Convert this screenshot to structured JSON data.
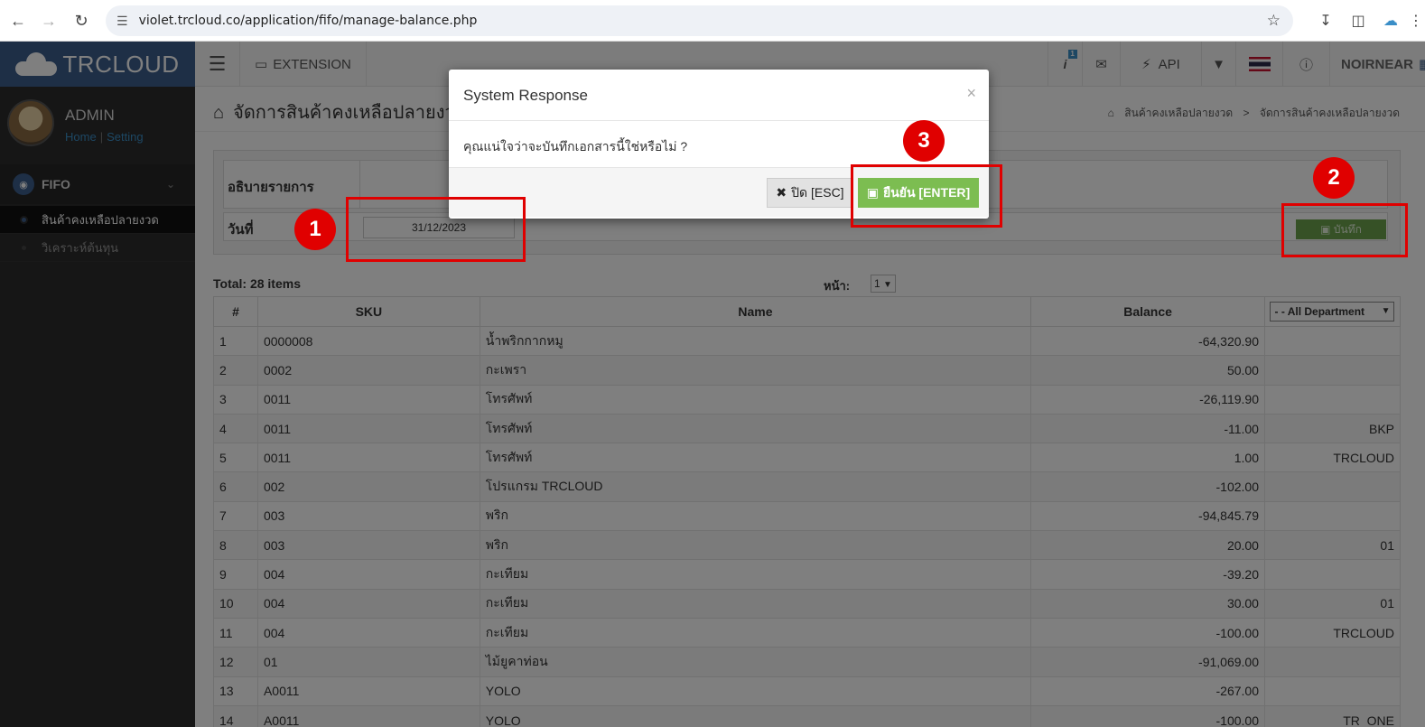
{
  "browser": {
    "url": "violet.trcloud.co/application/fifo/manage-balance.php"
  },
  "header": {
    "logo": "TRCLOUD",
    "extension_label": "EXTENSION",
    "api_label": "API",
    "user_label": "NOIRNEAR"
  },
  "sidebar": {
    "user_name": "ADMIN",
    "home_link": "Home",
    "setting_link": "Setting",
    "menu_label": "FIFO",
    "items": [
      {
        "label": "สินค้าคงเหลือปลายงวด"
      },
      {
        "label": "วิเคราะห์ต้นทุน"
      }
    ]
  },
  "page": {
    "title": "จัดการสินค้าคงเหลือปลายงวด",
    "breadcrumb": [
      "สินค้าคงเหลือปลายงวด",
      "จัดการสินค้าคงเหลือปลายงวด"
    ]
  },
  "form": {
    "desc_label": "อธิบายรายการ",
    "date_label": "วันที่",
    "date_value": "31/12/2023",
    "save_label": "บันทึก"
  },
  "table": {
    "total": "Total: 28 items",
    "page_label": "หน้า:",
    "page_value": "1",
    "headers": [
      "#",
      "SKU",
      "Name",
      "Balance"
    ],
    "dept_filter": "- - All Department",
    "rows": [
      {
        "n": "1",
        "sku": "0000008",
        "name": "น้ำพริกกากหมู",
        "balance": "-64,320.90",
        "dept": ""
      },
      {
        "n": "2",
        "sku": "0002",
        "name": "กะเพรา",
        "balance": "50.00",
        "dept": ""
      },
      {
        "n": "3",
        "sku": "0011",
        "name": "โทรศัพท์",
        "balance": "-26,119.90",
        "dept": ""
      },
      {
        "n": "4",
        "sku": "0011",
        "name": "โทรศัพท์",
        "balance": "-11.00",
        "dept": "BKP"
      },
      {
        "n": "5",
        "sku": "0011",
        "name": "โทรศัพท์",
        "balance": "1.00",
        "dept": "TRCLOUD"
      },
      {
        "n": "6",
        "sku": "002",
        "name": "โปรแกรม TRCLOUD",
        "balance": "-102.00",
        "dept": ""
      },
      {
        "n": "7",
        "sku": "003",
        "name": "พริก",
        "balance": "-94,845.79",
        "dept": ""
      },
      {
        "n": "8",
        "sku": "003",
        "name": "พริก",
        "balance": "20.00",
        "dept": "01"
      },
      {
        "n": "9",
        "sku": "004",
        "name": "กะเทียม",
        "balance": "-39.20",
        "dept": ""
      },
      {
        "n": "10",
        "sku": "004",
        "name": "กะเทียม",
        "balance": "30.00",
        "dept": "01"
      },
      {
        "n": "11",
        "sku": "004",
        "name": "กะเทียม",
        "balance": "-100.00",
        "dept": "TRCLOUD"
      },
      {
        "n": "12",
        "sku": "01",
        "name": "ไม้ยูคาท่อน",
        "balance": "-91,069.00",
        "dept": ""
      },
      {
        "n": "13",
        "sku": "A0011",
        "name": "YOLO",
        "balance": "-267.00",
        "dept": ""
      },
      {
        "n": "14",
        "sku": "A0011",
        "name": "YOLO",
        "balance": "-100.00",
        "dept": "TR_ONE"
      }
    ]
  },
  "modal": {
    "title": "System Response",
    "close_x": "×",
    "message": "คุณแน่ใจว่าจะบันทึกเอกสารนี้ใช่หรือไม่ ?",
    "close_label": "ปิด [ESC]",
    "confirm_label": "ยืนยัน [ENTER]"
  },
  "annotations": [
    "1",
    "2",
    "3"
  ],
  "colors": {
    "brand": "#3c5e8c",
    "confirm": "#7cbd51",
    "save": "#6da34d",
    "highlight": "#e00000"
  }
}
